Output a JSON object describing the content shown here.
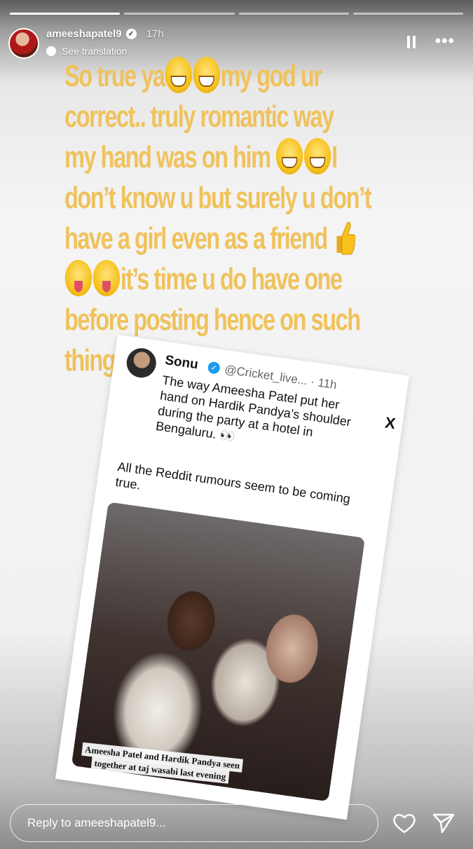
{
  "story": {
    "username": "ameeshapatel9",
    "time": "17h",
    "see_translation": "See translation",
    "progress": [
      1.0,
      0,
      0,
      0
    ],
    "caption": {
      "line1a": "So true ya",
      "line1b": "my god ur",
      "line2": "correct.. truly romantic way",
      "line3a": "my hand was on him",
      "line3b": "I",
      "line4": "don’t know u but surely u don’t",
      "line5": "have a girl even as a friend",
      "line6": "it’s time u do have one",
      "line7": "before posting  hence on such",
      "line8": "things .."
    },
    "icons": {
      "pause": "pause-icon",
      "more": "more-options-icon",
      "verified": "verified-badge-icon",
      "heart": "heart-icon",
      "send": "send-icon"
    }
  },
  "tweet": {
    "name": "Sonu",
    "handle": "@Cricket_live... · 11h",
    "text": "The way Ameesha Patel put her hand on Hardik Pandya’s shoulder during the party at a hotel in Bengaluru. 👀",
    "text2": "All the Reddit rumours seem to be coming true.",
    "caption_line1": "Ameesha Patel and Hardik Pandya seen",
    "caption_line2": "together at taj wasabi last evening",
    "close": "X"
  },
  "reply": {
    "placeholder": "Reply to ameeshapatel9..."
  }
}
